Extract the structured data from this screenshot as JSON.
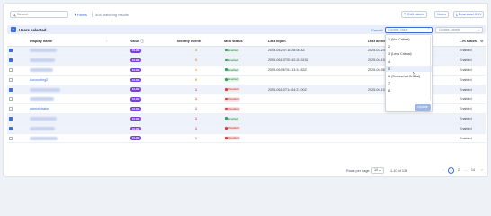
{
  "toolbar": {
    "search_placeholder": "Search",
    "filters_label": "Filters",
    "matching_text": "308 matching results",
    "edit_labels": "Edit Labels",
    "notes": "Notes",
    "download_csv": "Download CSV"
  },
  "selection": {
    "selected_text": "Users selected",
    "cancel": "Cancel",
    "update_value_placeholder": "Update Value",
    "update_labels_placeholder": "Update Labels"
  },
  "columns": {
    "display_name": "Display name",
    "value": "Value",
    "identity_events": "Identity events",
    "mfa_status": "MFA status",
    "last_logon": "Last logon",
    "last_active": "Last active",
    "system_states": "...m states"
  },
  "rows": [
    {
      "checked": true,
      "name": "",
      "blurred": true,
      "value": "10-DB",
      "events": "3",
      "events_color": "orange",
      "mfa": "Enabled",
      "mfa_state": "en",
      "last_logon": "2025-04-24T18:26:08.4Z",
      "last_active": "2025-04-24T18:26:27.0",
      "system": "Enabled"
    },
    {
      "checked": true,
      "name": "",
      "blurred": true,
      "value": "10-DB",
      "events": "0",
      "events_color": "orange",
      "mfa": "Enabled",
      "mfa_state": "en",
      "last_logon": "2025-06-10T00:42:28.315Z",
      "last_active": "2025-06-15T00:42:28.3",
      "system": "Enabled"
    },
    {
      "checked": false,
      "name": "",
      "blurred": true,
      "value": "10-DB",
      "events": "1",
      "events_color": "orange",
      "mfa": "Enabled",
      "mfa_state": "en",
      "last_logon": "2025-06-06T04:13:34.83Z",
      "last_active": "2025-06-06T04:13:34.8",
      "system": "Enabled"
    },
    {
      "checked": false,
      "name": "Accounting2",
      "blurred": false,
      "value": "10-DB",
      "events": "0",
      "events_color": "orange",
      "mfa": "Enabled",
      "mfa_state": "en",
      "last_logon": "",
      "last_active": "",
      "system": "Enabled"
    },
    {
      "checked": true,
      "name": "",
      "blurred": true,
      "value": "10-DB",
      "events": "1",
      "events_color": "red",
      "mfa": "Disabled",
      "mfa_state": "dis",
      "last_logon": "2025-06-10T14:54:21.00Z",
      "last_active": "2025-06-10T14:54:21.0",
      "system": "Enabled"
    },
    {
      "checked": false,
      "name": "",
      "blurred": true,
      "value": "10-DB",
      "events": "1",
      "events_color": "red",
      "mfa": "Disabled",
      "mfa_state": "dis",
      "last_logon": "",
      "last_active": "",
      "system": "Enabled"
    },
    {
      "checked": false,
      "name": "administrator",
      "blurred": false,
      "value": "10-DB",
      "events": "1",
      "events_color": "red",
      "mfa": "Disabled",
      "mfa_state": "dis",
      "last_logon": "",
      "last_active": "",
      "system": "Enabled"
    },
    {
      "checked": true,
      "name": "",
      "blurred": true,
      "value": "10-DB",
      "events": "1",
      "events_color": "red",
      "mfa": "Enabled",
      "mfa_state": "en",
      "last_logon": "",
      "last_active": "",
      "system": "Enabled"
    },
    {
      "checked": true,
      "name": "",
      "blurred": true,
      "value": "10-DB",
      "events": "1",
      "events_color": "red",
      "mfa": "Disabled",
      "mfa_state": "dis",
      "last_logon": "",
      "last_active": "",
      "system": "Enabled"
    },
    {
      "checked": false,
      "name": "",
      "blurred": true,
      "value": "10-DB",
      "events": "1",
      "events_color": "red",
      "mfa": "Disabled",
      "mfa_state": "dis",
      "last_logon": "",
      "last_active": "",
      "system": "Enabled"
    }
  ],
  "dropdown": {
    "options": [
      "1 (Not Critical)",
      "2",
      "3 (Less Critical)",
      "4",
      "5",
      "6 (Somewhat Critical)",
      "7",
      "8"
    ],
    "highlighted_index": 4,
    "update_button": "Update"
  },
  "footer": {
    "rows_per_page_label": "Rows per page:",
    "rows_per_page_value": "10",
    "range_text": "1-10 of 138",
    "pages": [
      "1",
      "2",
      "...",
      "14"
    ],
    "current_page": "1",
    "prev": "‹",
    "next": "›"
  },
  "colors": {
    "accent": "#3c6cd6",
    "value_pill": "#7b3fe0",
    "enabled": "#2a9d5c",
    "disabled": "#d63a3a"
  }
}
